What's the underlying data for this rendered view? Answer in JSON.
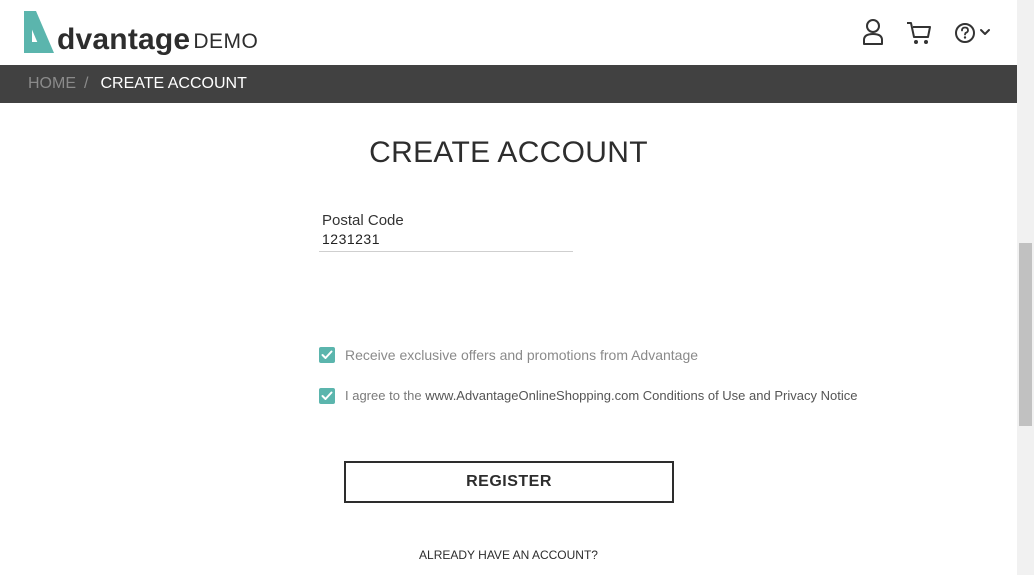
{
  "header": {
    "logo_letter": "A",
    "logo_text": "dvantage",
    "logo_suffix": "DEMO",
    "accent_color": "#5bb5ad"
  },
  "breadcrumb": {
    "home": "HOME",
    "separator": "/",
    "current": "CREATE ACCOUNT"
  },
  "page": {
    "title": "CREATE ACCOUNT"
  },
  "form": {
    "postal_code_label": "Postal Code",
    "postal_code_value": "1231231",
    "offers_checkbox": {
      "checked": true,
      "label": "Receive exclusive offers and promotions from Advantage"
    },
    "agree_checkbox": {
      "checked": true,
      "label_prefix": "I agree to the",
      "label_site": "www.AdvantageOnlineShopping.com",
      "label_conditions": "Conditions of Use",
      "label_and": "and",
      "label_privacy": "Privacy Notice"
    },
    "register_label": "REGISTER",
    "already_account": "ALREADY HAVE AN ACCOUNT?"
  },
  "icons": {
    "user": "user-icon",
    "cart": "cart-icon",
    "help": "help-icon",
    "chevron": "chevron-down-icon",
    "check": "check-icon"
  }
}
